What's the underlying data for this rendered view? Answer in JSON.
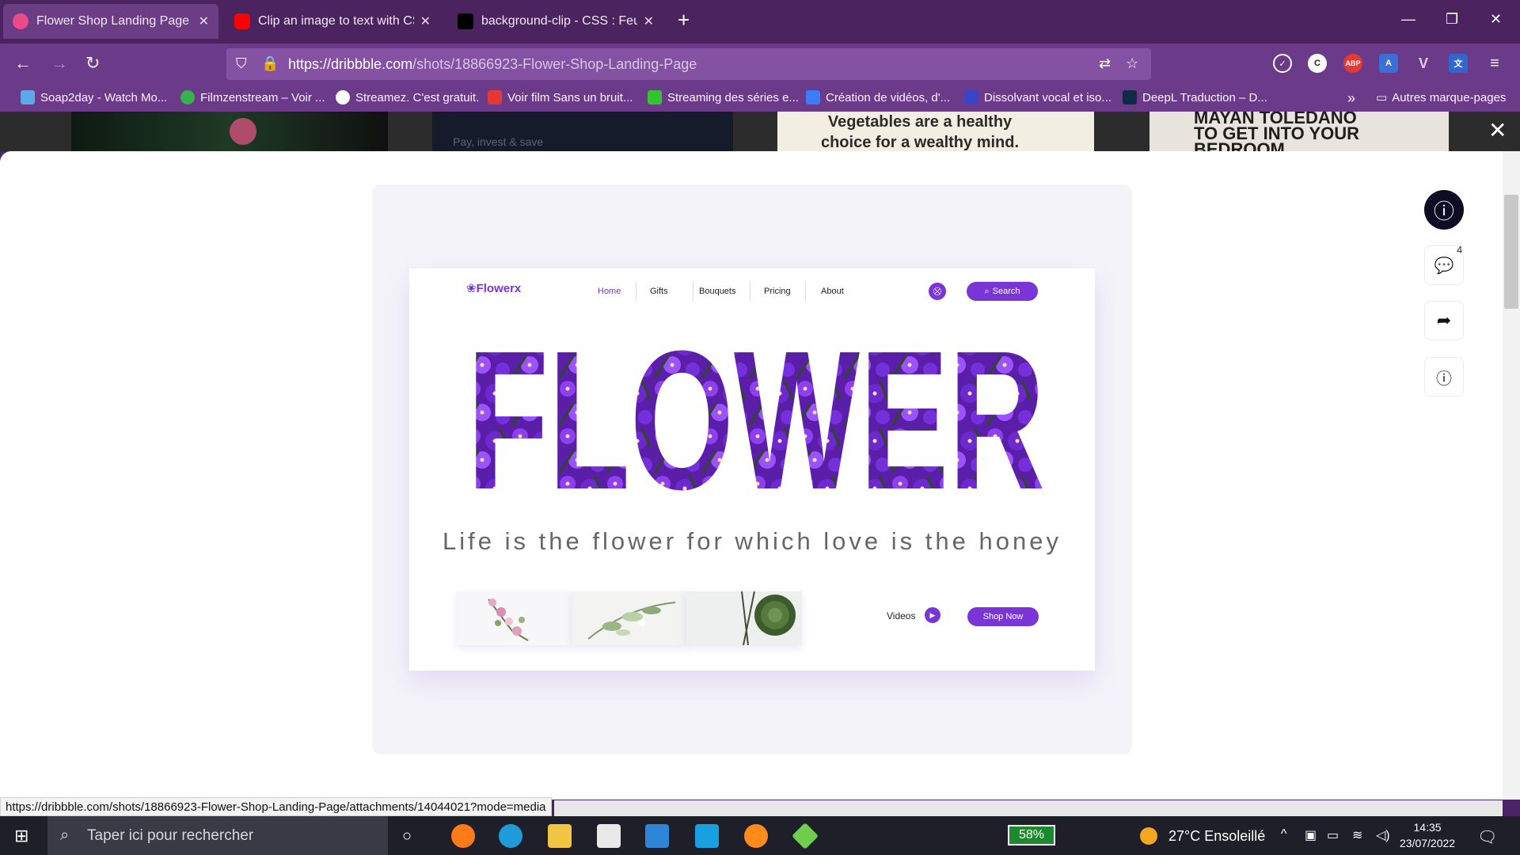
{
  "browser": {
    "tabs": [
      {
        "title": "Flower Shop Landing Page",
        "active": true,
        "favicon_color": "#ea4c89"
      },
      {
        "title": "Clip an image to text with CSS",
        "active": false,
        "favicon_color": "#ff0000"
      },
      {
        "title": "background-clip - CSS : Feuilles",
        "active": false,
        "favicon_color": "#000000"
      }
    ],
    "url_host": "https://dribbble.com",
    "url_path": "/shots/18866923-Flower-Shop-Landing-Page",
    "bookmarks": [
      {
        "label": "Soap2day - Watch Mo...",
        "color": "#5fa8e8"
      },
      {
        "label": "Filmzenstream – Voir ...",
        "color": "#35b34a"
      },
      {
        "label": "Streamez. C'est gratuit.",
        "color": "#ffffff"
      },
      {
        "label": "Voir film Sans un bruit...",
        "color": "#e53935"
      },
      {
        "label": "Streaming des séries e...",
        "color": "#32c232"
      },
      {
        "label": "Création de vidéos, d'...",
        "color": "#3c7cf6"
      },
      {
        "label": "Dissolvant vocal et iso...",
        "color": "#3b44c6"
      },
      {
        "label": "DeepL Traduction – D...",
        "color": "#0f2b46"
      }
    ],
    "other_bookmarks": "Autres marque-pages",
    "status_url": "https://dribbble.com/shots/18866923-Flower-Shop-Landing-Page/attachments/14044021?mode=media"
  },
  "shot": {
    "logo": "Flowerx",
    "nav": [
      "Home",
      "Gifts",
      "Bouquets",
      "Pricing",
      "About"
    ],
    "search_label": "Search",
    "hero_word": "FLOWER",
    "tagline": "Life is the flower for which love is the honey",
    "videos_label": "Videos",
    "shop_now": "Shop Now"
  },
  "sidebar": {
    "comment_count": "4"
  },
  "backdrop_text": {
    "left": "Pay, invest & save",
    "mid": "Vegetables are a healthy choice for a wealthy mind.",
    "right": "MAYAN TOLEDANO TO GET INTO YOUR BEDROOM"
  },
  "taskbar": {
    "search_placeholder": "Taper ici pour rechercher",
    "battery": "58%",
    "weather": "27°C  Ensoleillé",
    "time": "14:35",
    "date": "23/07/2022"
  },
  "colors": {
    "accent": "#7a35d6",
    "chrome": "#6b3a88"
  }
}
